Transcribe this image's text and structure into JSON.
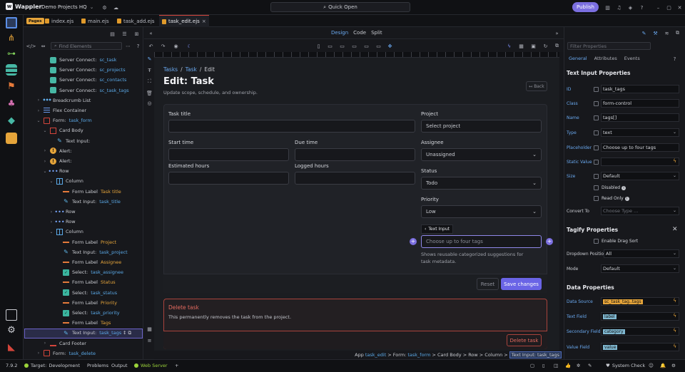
{
  "app": {
    "name": "Wappler",
    "project": "Demo Projects HQ",
    "quick_open": "Quick Open",
    "publish": "Publish"
  },
  "tabs": {
    "badge": "Pages",
    "files": [
      "index.ejs",
      "main.ejs",
      "task_add.ejs",
      "task_edit.ejs"
    ],
    "active": "task_edit.ejs",
    "close": "×"
  },
  "tree": {
    "find_placeholder": "Find Elements",
    "rows": [
      {
        "label": "Server Connect:",
        "sub": "sc_task"
      },
      {
        "label": "Server Connect:",
        "sub": "sc_projects"
      },
      {
        "label": "Server Connect:",
        "sub": "sc_contacts"
      },
      {
        "label": "Server Connect:",
        "sub": "sc_task_tags"
      },
      {
        "label": "Breadcrumb List",
        "sub": ""
      },
      {
        "label": "Flex Container",
        "sub": ""
      },
      {
        "label": "Form:",
        "sub": "task_form"
      },
      {
        "label": "Card Body",
        "sub": ""
      },
      {
        "label": "Text Input:",
        "sub": ""
      },
      {
        "label": "Alert:",
        "sub": ""
      },
      {
        "label": "Alert:",
        "sub": ""
      },
      {
        "label": "Row",
        "sub": ""
      },
      {
        "label": "Column",
        "sub": ""
      },
      {
        "label": "Form Label",
        "sub": "Task title"
      },
      {
        "label": "Text Input:",
        "sub": "task_title"
      },
      {
        "label": "Row",
        "sub": ""
      },
      {
        "label": "Row",
        "sub": ""
      },
      {
        "label": "Column",
        "sub": ""
      },
      {
        "label": "Form Label",
        "sub": "Project"
      },
      {
        "label": "Text Input:",
        "sub": "task_project"
      },
      {
        "label": "Form Label",
        "sub": "Assignee"
      },
      {
        "label": "Select:",
        "sub": "task_assignee"
      },
      {
        "label": "Form Label",
        "sub": "Status"
      },
      {
        "label": "Select:",
        "sub": "task_status"
      },
      {
        "label": "Form Label",
        "sub": "Priority"
      },
      {
        "label": "Select:",
        "sub": "task_priority"
      },
      {
        "label": "Form Label",
        "sub": "Tags"
      },
      {
        "label": "Text Input:",
        "sub": "task_tags"
      },
      {
        "label": "Card Footer",
        "sub": ""
      },
      {
        "label": "Form:",
        "sub": "task_delete"
      }
    ]
  },
  "view_modes": [
    "Design",
    "Code",
    "Split"
  ],
  "page": {
    "crumbs": [
      "Tasks",
      "/",
      "Task",
      "/",
      "Edit"
    ],
    "title": "Edit: Task",
    "subtitle": "Update scope, schedule, and ownership.",
    "back": "Back",
    "labels": {
      "task_title": "Task title",
      "project": "Project",
      "start": "Start time",
      "due": "Due time",
      "estimated": "Estimated hours",
      "logged": "Logged hours",
      "assignee": "Assignee",
      "status": "Status",
      "priority": "Priority"
    },
    "values": {
      "project": "Select project",
      "assignee": "Unassigned",
      "status": "Todo",
      "priority": "Low"
    },
    "tags_placeholder": "Choose up to four tags",
    "tags_hint": "Shows reusable categorized suggestions for task metadata.",
    "tooltip": "Text Input",
    "reset": "Reset",
    "save": "Save changes",
    "danger_title": "Delete task",
    "danger_text": "This permanently removes the task from the project.",
    "delete": "Delete task"
  },
  "breadcrumb_bar": [
    {
      "t": "App",
      "s": false,
      "h": false
    },
    {
      "t": "task_edit",
      "s": false,
      "h": true
    },
    {
      "t": "> Form:",
      "s": false,
      "h": false
    },
    {
      "t": "task_form",
      "s": false,
      "h": true
    },
    {
      "t": "> Card Body > Row > Column >",
      "s": false,
      "h": false
    },
    {
      "t": "Text Input: task_tags",
      "s": true,
      "h": false
    }
  ],
  "props": {
    "filter_placeholder": "Filter Properties",
    "tabs": [
      "General",
      "Attributes",
      "Events"
    ],
    "section1": "Text Input Properties",
    "fields": [
      {
        "label": "ID",
        "value": "task_tags"
      },
      {
        "label": "Class",
        "value": "form-control"
      },
      {
        "label": "Name",
        "value": "tags[]"
      },
      {
        "label": "Type",
        "value": "text"
      },
      {
        "label": "Placeholder",
        "value": "Choose up to four tags"
      },
      {
        "label": "Static Value",
        "value": ""
      },
      {
        "label": "Size",
        "value": "Default"
      }
    ],
    "disabled": "Disabled",
    "read_only": "Read Only",
    "convert_to": "Convert To",
    "convert_placeholder": "Choose Type ...",
    "section2": "Tagify Properties",
    "drag_sort": "Enable Drag Sort",
    "dropdown_position_label": "Dropdown Position",
    "dropdown_position": "All",
    "mode_label": "Mode",
    "mode": "Default",
    "section3": "Data Properties",
    "data_source_label": "Data Source",
    "data_source": "sc_task_tag..tags",
    "text_field_label": "Text Field",
    "text_field": "label",
    "secondary_field_label": "Secondary Field",
    "secondary_field": "category",
    "value_field_label": "Value Field",
    "value_field": "value"
  },
  "status": {
    "version": "7.9.2",
    "target_label": "Target:",
    "target": "Development",
    "problems": "Problems",
    "output": "Output",
    "web_server": "Web Server",
    "system_check": "System Check"
  },
  "colors": {
    "accent": "#7b6fe0",
    "link": "#6aa9f0",
    "danger": "#d4453b",
    "warning": "#e5a43a"
  }
}
